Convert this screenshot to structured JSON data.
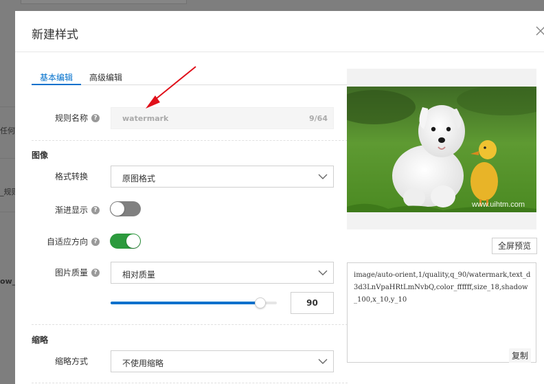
{
  "background": {
    "texts": [
      "任何时",
      "_规则",
      "ow_"
    ]
  },
  "modal": {
    "title": "新建样式",
    "tabs": [
      {
        "label": "基本编辑",
        "active": true
      },
      {
        "label": "高级编辑",
        "active": false
      }
    ],
    "rule_name": {
      "label": "规则名称",
      "value": "watermark",
      "counter": "9/64"
    },
    "image_section": {
      "title": "图像",
      "format_conversion": {
        "label": "格式转换",
        "selected": "原图格式"
      },
      "progressive_display": {
        "label": "渐进显示",
        "on": false
      },
      "auto_orient": {
        "label": "自适应方向",
        "on": true
      },
      "image_quality": {
        "label": "图片质量",
        "selected": "相对质量",
        "slider_percent": 90,
        "value": "90"
      }
    },
    "thumbnail_section": {
      "title": "缩略",
      "thumbnail_mode": {
        "label": "缩略方式",
        "selected": "不使用缩略"
      }
    },
    "preview": {
      "watermark_text": "www.uihtm.com",
      "fullscreen_label": "全屏预览",
      "code": "image/auto-orient,1/quality,q_90/watermark,text_d3d3LnVpaHRtLmNvbQ,color_ffffff,size_18,shadow_100,x_10,y_10",
      "copy_label": "复制"
    }
  },
  "colors": {
    "accent": "#0070cc",
    "toggle_on": "#2c9a3d",
    "toggle_off": "#808080",
    "arrow": "#e0101a"
  }
}
